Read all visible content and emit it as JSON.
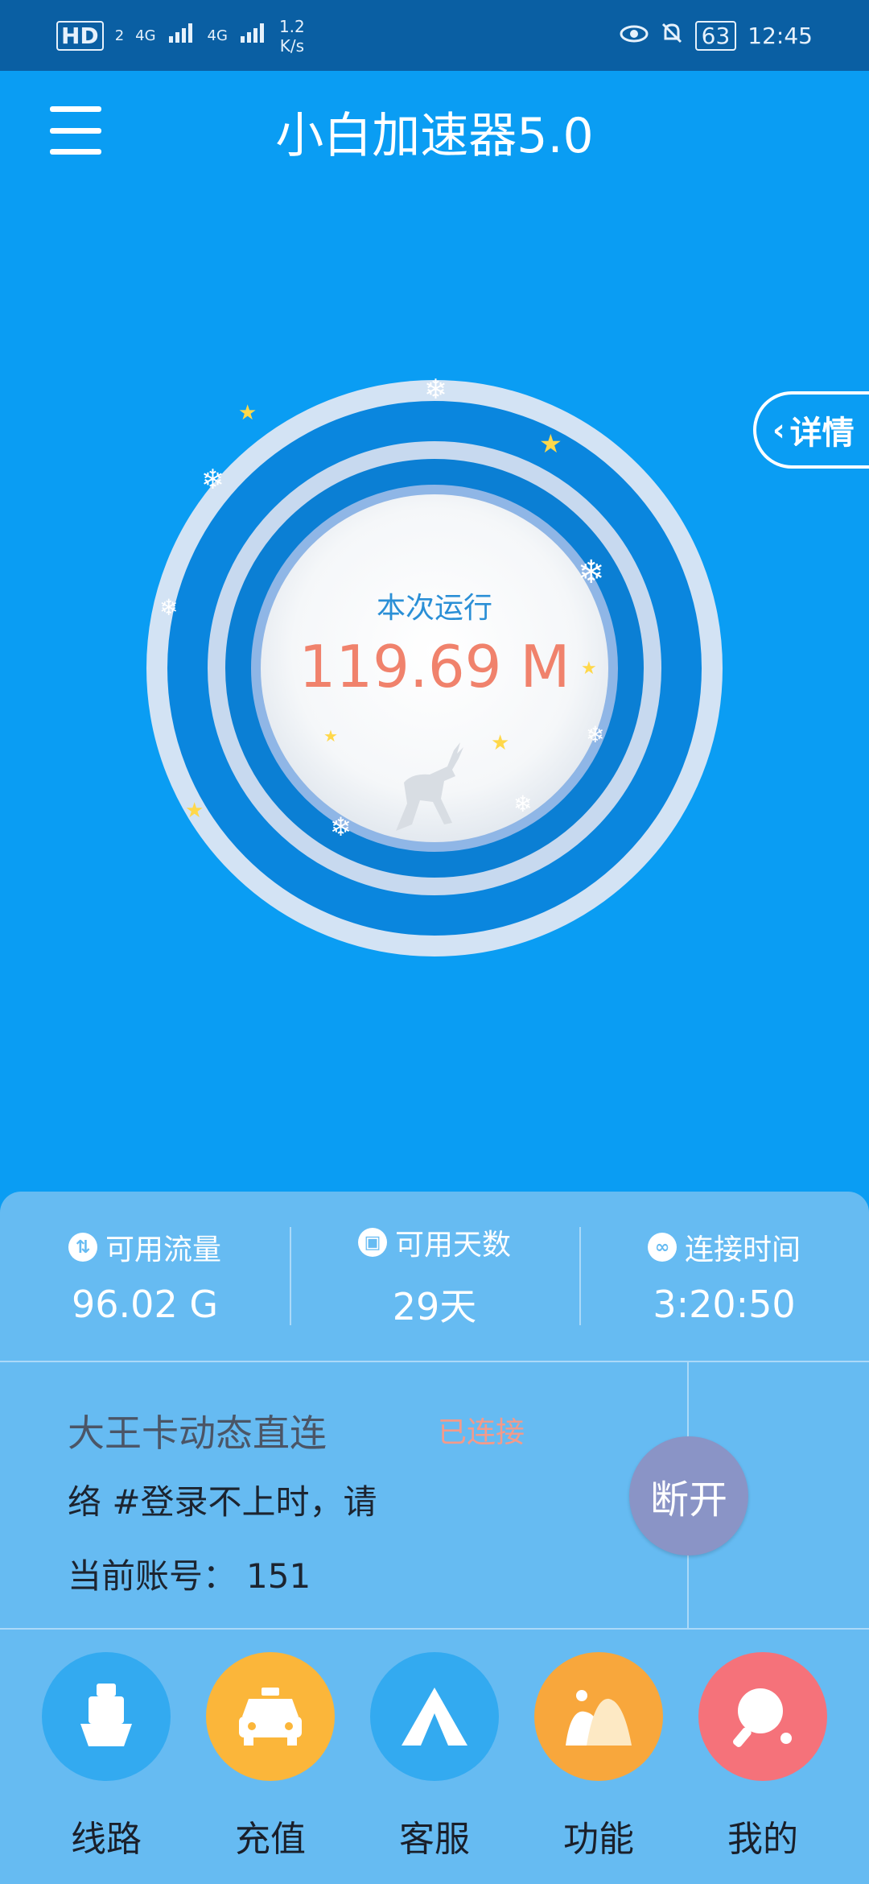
{
  "status_bar": {
    "hd_badge": "HD",
    "hd_sub": "2",
    "net1": "4G",
    "net2": "4G",
    "speed_value": "1.2",
    "speed_unit": "K/s",
    "battery": "63",
    "time": "12:45"
  },
  "app_bar": {
    "title": "小白加速器5.0"
  },
  "hero": {
    "details_label": "详情",
    "run_label": "本次运行",
    "run_value": "119.69 M"
  },
  "stats": [
    {
      "label": "可用流量",
      "value": "96.02 G",
      "icon": "traffic-icon"
    },
    {
      "label": "可用天数",
      "value": "29天",
      "icon": "calendar-icon"
    },
    {
      "label": "连接时间",
      "value": "3:20:50",
      "icon": "link-icon"
    }
  ],
  "route": {
    "name": "大王卡动态直连",
    "status": "已连接",
    "notice": "络                    #登录不上时，请",
    "account_label": "当前账号：",
    "account_value": "151",
    "disconnect_label": "断开"
  },
  "nav": [
    {
      "label": "线路",
      "icon": "ship-icon",
      "color": "#33aaf0"
    },
    {
      "label": "充值",
      "icon": "taxi-icon",
      "color": "#fbb63a"
    },
    {
      "label": "客服",
      "icon": "tent-icon",
      "color": "#33aaf0"
    },
    {
      "label": "功能",
      "icon": "mountain-icon",
      "color": "#f8a73c"
    },
    {
      "label": "我的",
      "icon": "pingpong-icon",
      "color": "#f5727a"
    }
  ],
  "colors": {
    "primary": "#0a9df3",
    "panel": "#66bbf2",
    "run_value": "#f0826c",
    "connected": "#f49a8a",
    "disconnect": "#8a94c6"
  }
}
